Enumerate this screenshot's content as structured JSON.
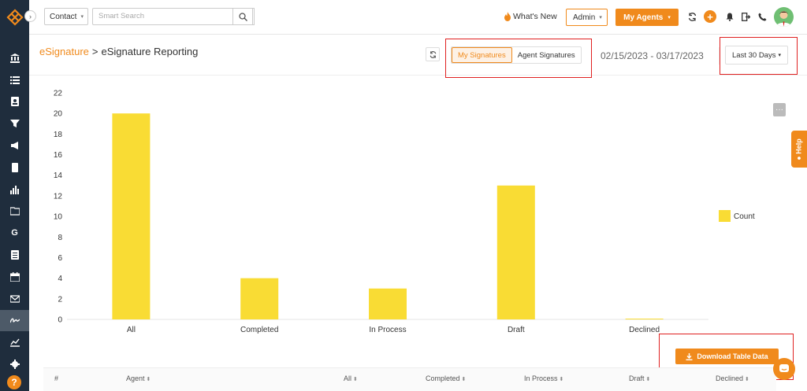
{
  "topbar": {
    "contact_label": "Contact",
    "search_placeholder": "Smart Search",
    "whats_new": "What's New",
    "admin_label": "Admin",
    "agents_label": "My Agents"
  },
  "page": {
    "breadcrumb_link": "eSignature",
    "breadcrumb_sep": ">",
    "breadcrumb_current": "eSignature Reporting",
    "tabs": [
      {
        "label": "My Signatures",
        "active": true
      },
      {
        "label": "Agent Signatures",
        "active": false
      }
    ],
    "date_range": "02/15/2023 - 03/17/2023",
    "period": "Last 30 Days",
    "help_tab": "Help",
    "download_label": "Download Table Data"
  },
  "chart_data": {
    "type": "bar",
    "categories": [
      "All",
      "Completed",
      "In Process",
      "Draft",
      "Declined"
    ],
    "series": [
      {
        "name": "Count",
        "values": [
          20,
          4,
          3,
          13,
          0
        ],
        "color": "#f9dc34"
      }
    ],
    "ylim": [
      0,
      22
    ],
    "yticks": [
      0,
      2,
      4,
      6,
      8,
      10,
      12,
      14,
      16,
      18,
      20,
      22
    ],
    "legend": "right",
    "grid": false
  },
  "table": {
    "columns": [
      "#",
      "Agent",
      "All",
      "Completed",
      "In Process",
      "Draft",
      "Declined"
    ]
  },
  "colors": {
    "accent": "#f08a1c",
    "sidebar": "#1f2d3d",
    "bar": "#f9dc34"
  }
}
